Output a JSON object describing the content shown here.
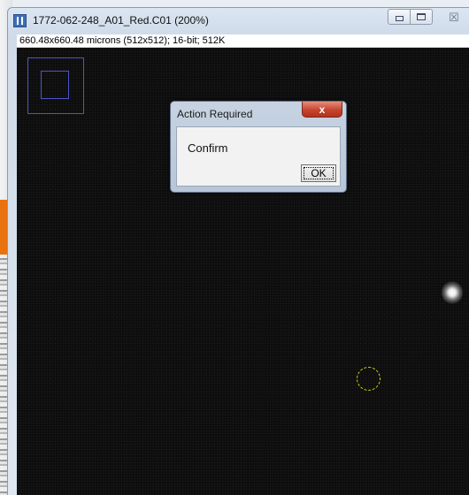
{
  "window": {
    "title": "1772-062-248_A01_Red.C01 (200%)",
    "info": "660.48x660.48 microns (512x512); 16-bit; 512K"
  },
  "dialog": {
    "title": "Action Required",
    "message": "Confirm",
    "ok_label": "OK",
    "close_glyph": "x"
  },
  "controls": {
    "minimize_icon": "minimize-icon",
    "maximize_icon": "maximize-icon",
    "close_glyph": "☒"
  },
  "colors": {
    "roi_circle": "#d2d21e",
    "navigator": "#4b55c8",
    "dialog_close": "#c6452f",
    "side_tab": "#e8730f"
  }
}
